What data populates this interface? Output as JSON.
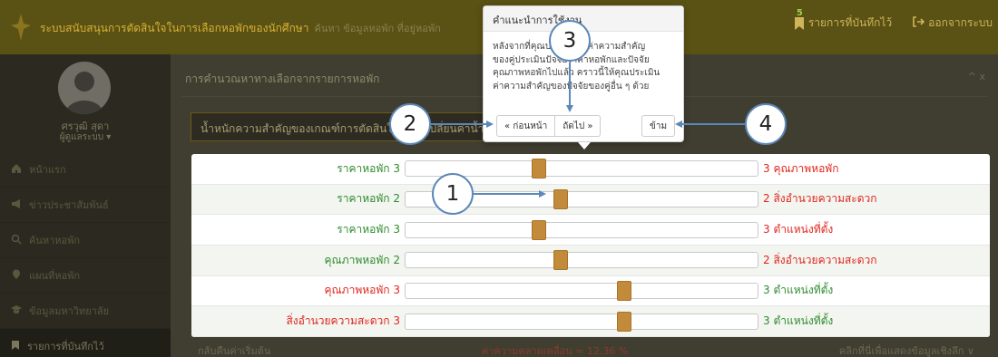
{
  "topbar": {
    "title": "ระบบสนับสนุนการตัดสินใจในการเลือกหอพักของนักศึกษา",
    "subtitle": "ค้นหา ข้อมูลหอพัก ที่อยู่หอพัก",
    "bookmark_count": "5",
    "bookmarks_label": "รายการที่บันทึกไว้",
    "logout_label": "ออกจากระบบ"
  },
  "sidebar": {
    "user_name": "ศรวุฒิ สุดา",
    "user_role": "ผู้ดูแลระบบ ▾",
    "items": [
      {
        "label": "หน้าแรก",
        "icon": "home-icon"
      },
      {
        "label": "ข่าวประชาสัมพันธ์",
        "icon": "megaphone-icon"
      },
      {
        "label": "ค้นหาหอพัก",
        "icon": "search-icon"
      },
      {
        "label": "แผนที่หอพัก",
        "icon": "map-pin-icon"
      },
      {
        "label": "ข้อมูลมหาวิทยาลัย",
        "icon": "graduation-cap-icon"
      },
      {
        "label": "รายการที่บันทึกไว้",
        "icon": "bookmark-icon"
      }
    ]
  },
  "panel": {
    "title": "การคำนวณหาทางเลือกจากรายการหอพัก",
    "controls": "^ x",
    "section_title": "น้ำหนักความสำคัญของเกณฑ์การตัดสินใจ (ปรับเปลี่ยนค่าน้ำหนักความสำคัญ)"
  },
  "comparisons": [
    {
      "left": "ราคาหอพัก",
      "left_value": "3",
      "right": "คุณภาพหอพัก",
      "right_value": "3",
      "position": 0.38,
      "left_color": "green",
      "right_color": "red"
    },
    {
      "left": "ราคาหอพัก",
      "left_value": "2",
      "right": "สิ่งอำนวยความสะดวก",
      "right_value": "2",
      "position": 0.44,
      "left_color": "green",
      "right_color": "red"
    },
    {
      "left": "ราคาหอพัก",
      "left_value": "3",
      "right": "ตำแหน่งที่ตั้ง",
      "right_value": "3",
      "position": 0.38,
      "left_color": "green",
      "right_color": "red"
    },
    {
      "left": "คุณภาพหอพัก",
      "left_value": "2",
      "right": "สิ่งอำนวยความสะดวก",
      "right_value": "2",
      "position": 0.44,
      "left_color": "green",
      "right_color": "red"
    },
    {
      "left": "คุณภาพหอพัก",
      "left_value": "3",
      "right": "ตำแหน่งที่ตั้ง",
      "right_value": "3",
      "position": 0.62,
      "left_color": "red",
      "right_color": "green"
    },
    {
      "left": "สิ่งอำนวยความสะดวก",
      "left_value": "3",
      "right": "ตำแหน่งที่ตั้ง",
      "right_value": "3",
      "position": 0.62,
      "left_color": "red",
      "right_color": "green"
    }
  ],
  "popover": {
    "title": "คำแนะนำการใช้งาน",
    "body_lines": [
      "หลังจากที่คุณปรับเปลี่ยนค่าความสำคัญ",
      "ของคู่ประเมินปัจจัยราคาหอพักและปัจจัย",
      "คุณภาพหอพักไปแล้ว คราวนี้ให้คุณประเมิน",
      "ค่าความสำคัญของปัจจัยของคู่อื่น ๆ ด้วย"
    ],
    "prev_label": "« ก่อนหน้า",
    "next_label": "ถัดไป »",
    "skip_label": "ข้าม"
  },
  "bottom": {
    "back_link": "กลับคืนค่าเริ่มต้น",
    "consistency": "ค่าความคลาดเคลื่อน = 12.36 %",
    "detail_link": "คลิกที่นี่เพื่อแสดงข้อมูลเชิงลึก ∨"
  },
  "callouts": [
    "1",
    "2",
    "3",
    "4"
  ],
  "colors": {
    "accent": "#c28a3b",
    "green": "#2e8b2e",
    "red": "#e0261d",
    "callout": "#5b87b9"
  }
}
